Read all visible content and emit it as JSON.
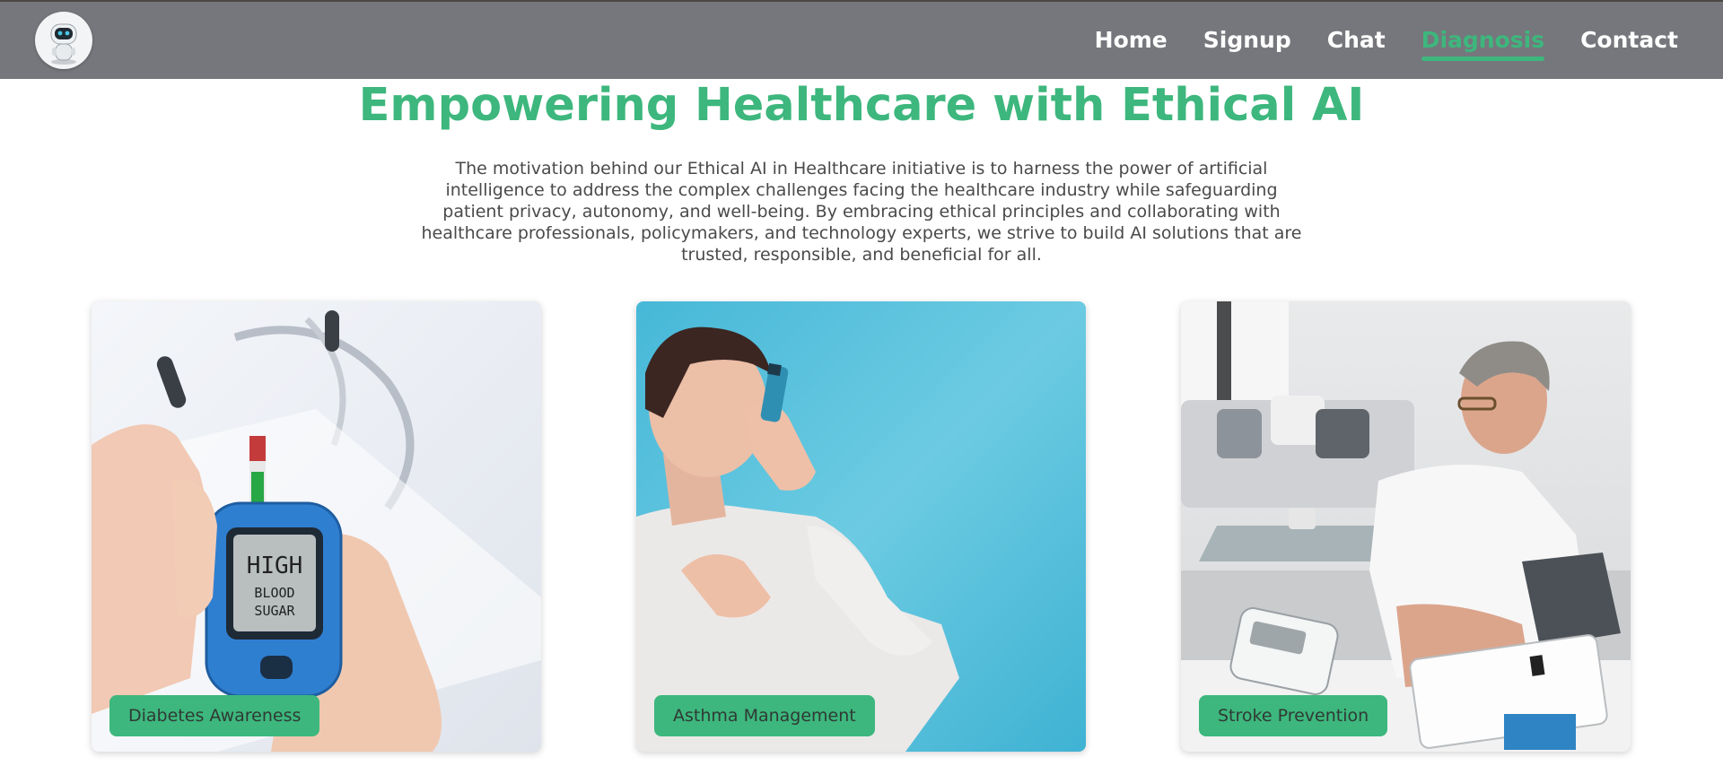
{
  "nav": {
    "links": [
      {
        "label": "Home",
        "active": false
      },
      {
        "label": "Signup",
        "active": false
      },
      {
        "label": "Chat",
        "active": false
      },
      {
        "label": "Diagnosis",
        "active": true
      },
      {
        "label": "Contact",
        "active": false
      }
    ]
  },
  "hero": {
    "title": "Empowering Healthcare with Ethical AI",
    "text": "The motivation behind our Ethical AI in Healthcare initiative is to harness the power of artificial intelligence to address the complex challenges facing the healthcare industry while safeguarding patient privacy, autonomy, and well-being. By embracing ethical principles and collaborating with healthcare professionals, policymakers, and technology experts, we strive to build AI solutions that are trusted, responsible, and beneficial for all."
  },
  "cards": [
    {
      "label": "Diabetes Awareness",
      "meter_text": [
        "HIGH",
        "BLOOD",
        "SUGAR"
      ]
    },
    {
      "label": "Asthma Management"
    },
    {
      "label": "Stroke Prevention"
    }
  ],
  "colors": {
    "accent": "#3db77d",
    "navbar": "#76777c",
    "body_text": "#4a4a4a"
  }
}
